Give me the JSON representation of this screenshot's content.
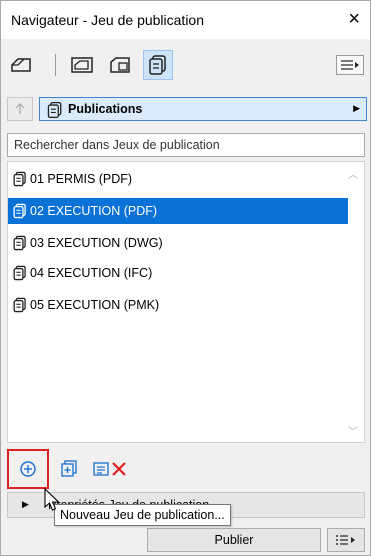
{
  "window": {
    "title": "Navigateur - Jeu de publication",
    "close_glyph": "×"
  },
  "toolbar": {
    "buttons": [
      {
        "name": "project-map-icon"
      },
      {
        "name": "view-map-icon"
      },
      {
        "name": "layout-book-icon"
      },
      {
        "name": "publisher-sets-icon",
        "active": true
      }
    ],
    "menu_icon": "menu-icon"
  },
  "pathbar": {
    "label": "Publications"
  },
  "search": {
    "placeholder": "Rechercher dans Jeux de publication"
  },
  "list": {
    "items": [
      {
        "label": "01 PERMIS (PDF)",
        "selected": false
      },
      {
        "label": "02 EXECUTION (PDF)",
        "selected": true
      },
      {
        "label": "03 EXECUTION (DWG)",
        "selected": false
      },
      {
        "label": "04 EXECUTION (IFC)",
        "selected": false
      },
      {
        "label": "05 EXECUTION (PMK)",
        "selected": false
      }
    ]
  },
  "bottombar": {
    "buttons": [
      "add-set-icon",
      "add-folder-icon",
      "properties-list-icon",
      "delete-icon"
    ]
  },
  "properties": {
    "label": "Propriétés Jeu de publication"
  },
  "tooltip": {
    "text": "Nouveau Jeu de publication..."
  },
  "footer": {
    "publish_label": "Publier"
  },
  "colors": {
    "selection": "#0a72d6",
    "highlight": "#e02020",
    "delete": "#e02020",
    "add": "#1a6fd0"
  }
}
